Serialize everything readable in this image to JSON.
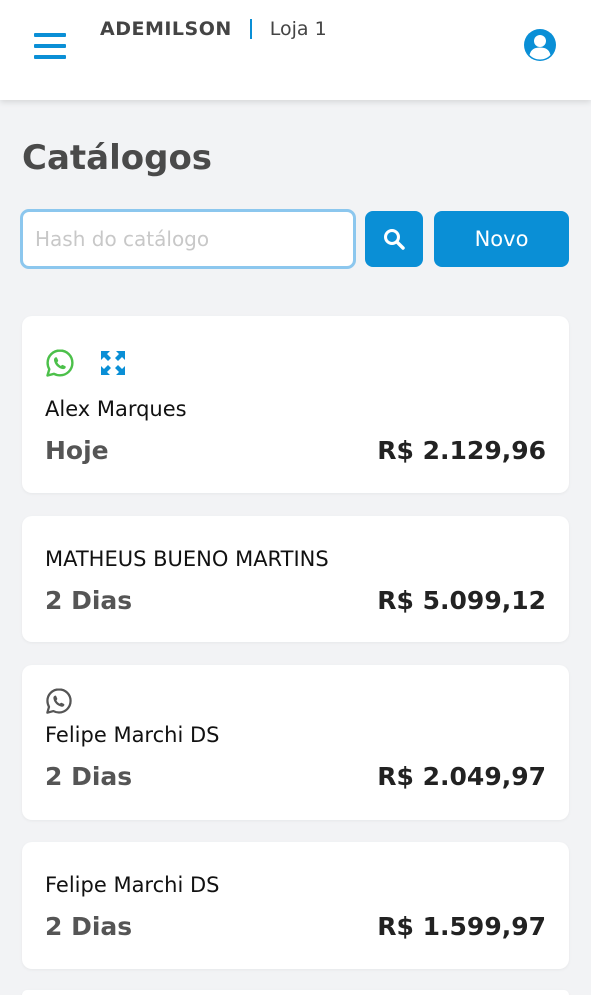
{
  "header": {
    "company": "ADEMILSON",
    "store": "Loja 1",
    "menu_icon": "hamburger-menu-icon",
    "user_icon": "user-circle-icon"
  },
  "page": {
    "title": "Catálogos"
  },
  "search": {
    "value": "",
    "placeholder": "Hash do catálogo",
    "button_icon": "search-icon",
    "new_label": "Novo"
  },
  "catalogs": [
    {
      "name": "Alex Marques",
      "age": "Hoje",
      "total": "R$ 2.129,96",
      "icons": [
        "whatsapp-green-icon",
        "expand-icon"
      ]
    },
    {
      "name": "MATHEUS BUENO MARTINS",
      "age": "2 Dias",
      "total": "R$ 5.099,12",
      "icons": []
    },
    {
      "name": "Felipe Marchi DS",
      "age": "2 Dias",
      "total": "R$ 2.049,97",
      "icons": [
        "whatsapp-gray-icon"
      ]
    },
    {
      "name": "Felipe Marchi DS",
      "age": "2 Dias",
      "total": "R$ 1.599,97",
      "icons": []
    }
  ],
  "colors": {
    "accent": "#0a8fd6",
    "whatsapp": "#4cc04a",
    "background": "#f2f3f5"
  }
}
